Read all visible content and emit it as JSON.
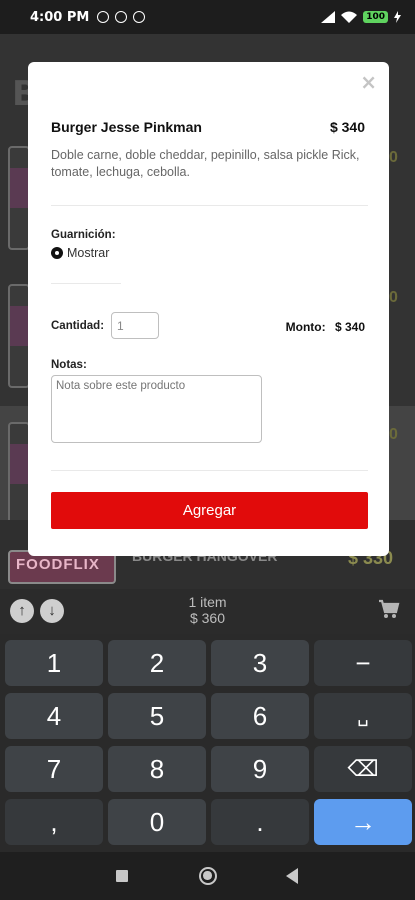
{
  "status_bar": {
    "time": "4:00 PM",
    "battery": "100"
  },
  "background": {
    "title_fragment": "B",
    "price_fragments": [
      "0",
      "0",
      "0"
    ],
    "next_item": {
      "thumb_text": "FOODFLIX",
      "name": "BURGER HANGOVER",
      "price": "$ 330"
    }
  },
  "modal": {
    "close_symbol": "×",
    "product": {
      "name": "Burger Jesse Pinkman",
      "price": "$ 340",
      "description": "Doble carne, doble cheddar, pepinillo, salsa pickle Rick, tomate, lechuga, cebolla."
    },
    "garnish": {
      "label": "Guarnición:",
      "selected_option": "Mostrar"
    },
    "quantity": {
      "label": "Cantidad:",
      "value": "1"
    },
    "amount": {
      "label": "Monto:",
      "value": "$ 340"
    },
    "notes": {
      "label": "Notas:",
      "placeholder": "Nota sobre este producto"
    },
    "add_button": "Agregar"
  },
  "cart_bar": {
    "items_count": "1 item",
    "total": "$ 360"
  },
  "keyboard": {
    "rows": [
      [
        "1",
        "2",
        "3",
        "−"
      ],
      [
        "4",
        "5",
        "6",
        "␣"
      ],
      [
        "7",
        "8",
        "9",
        "⌫"
      ],
      [
        ",",
        "0",
        ".",
        "→"
      ]
    ]
  },
  "colors": {
    "accent_red": "#e10b0b",
    "keyboard_enter": "#5d9cef"
  }
}
